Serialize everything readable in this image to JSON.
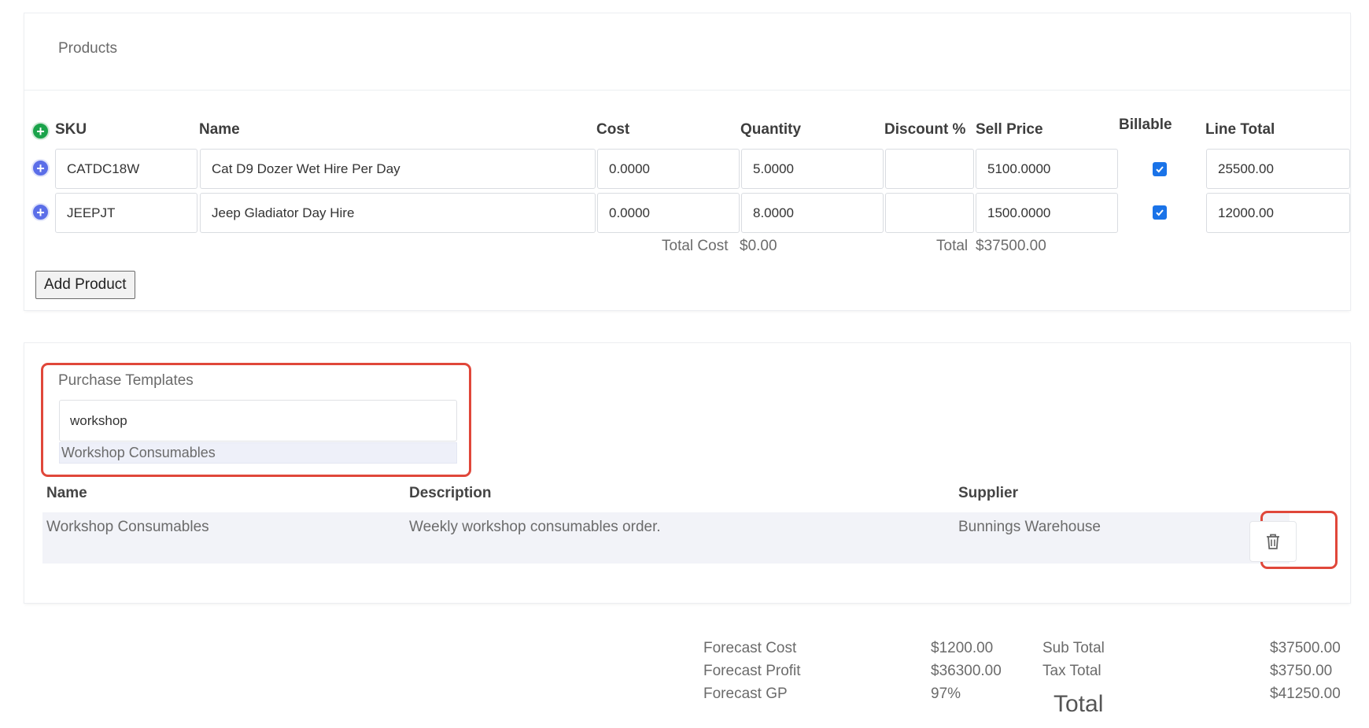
{
  "products": {
    "title": "Products",
    "columns": {
      "sku": "SKU",
      "name": "Name",
      "cost": "Cost",
      "quantity": "Quantity",
      "discount": "Discount %",
      "sell_price": "Sell Price",
      "billable": "Billable",
      "line_total": "Line Total"
    },
    "rows": [
      {
        "sku": "CATDC18W",
        "name": "Cat D9 Dozer Wet Hire Per Day",
        "cost": "0.0000",
        "quantity": "5.0000",
        "discount": "",
        "sell_price": "5100.0000",
        "billable": true,
        "line_total": "25500.00"
      },
      {
        "sku": "JEEPJT",
        "name": "Jeep Gladiator Day Hire",
        "cost": "0.0000",
        "quantity": "8.0000",
        "discount": "",
        "sell_price": "1500.0000",
        "billable": true,
        "line_total": "12000.00"
      }
    ],
    "total_cost_label": "Total Cost",
    "total_cost_value": "$0.00",
    "total_label": "Total",
    "total_value": "$37500.00",
    "add_button": "Add Product",
    "add_icon": "plus-circle-icon",
    "row_icon": "plus-circle-icon",
    "accent_colors": {
      "add": "#1aa34a",
      "row": "#5b6ee8",
      "checkbox": "#1a73e8",
      "highlight": "#e0473a"
    }
  },
  "purchase_templates": {
    "title": "Purchase Templates",
    "search_value": "workshop",
    "suggestion": "Workshop Consumables",
    "columns": {
      "name": "Name",
      "description": "Description",
      "supplier": "Supplier"
    },
    "rows": [
      {
        "name": "Workshop Consumables",
        "description": "Weekly workshop consumables order.",
        "supplier": "Bunnings Warehouse",
        "action_icon": "trash-icon"
      }
    ]
  },
  "totals": {
    "forecast_cost_label": "Forecast Cost",
    "forecast_cost_value": "$1200.00",
    "forecast_profit_label": "Forecast Profit",
    "forecast_profit_value": "$36300.00",
    "forecast_gp_label": "Forecast GP",
    "forecast_gp_value": "97%",
    "sub_total_label": "Sub Total",
    "sub_total_value": "$37500.00",
    "tax_total_label": "Tax Total",
    "tax_total_value": "$3750.00",
    "grand_total_value": "$41250.00",
    "total_heading": "Total"
  }
}
